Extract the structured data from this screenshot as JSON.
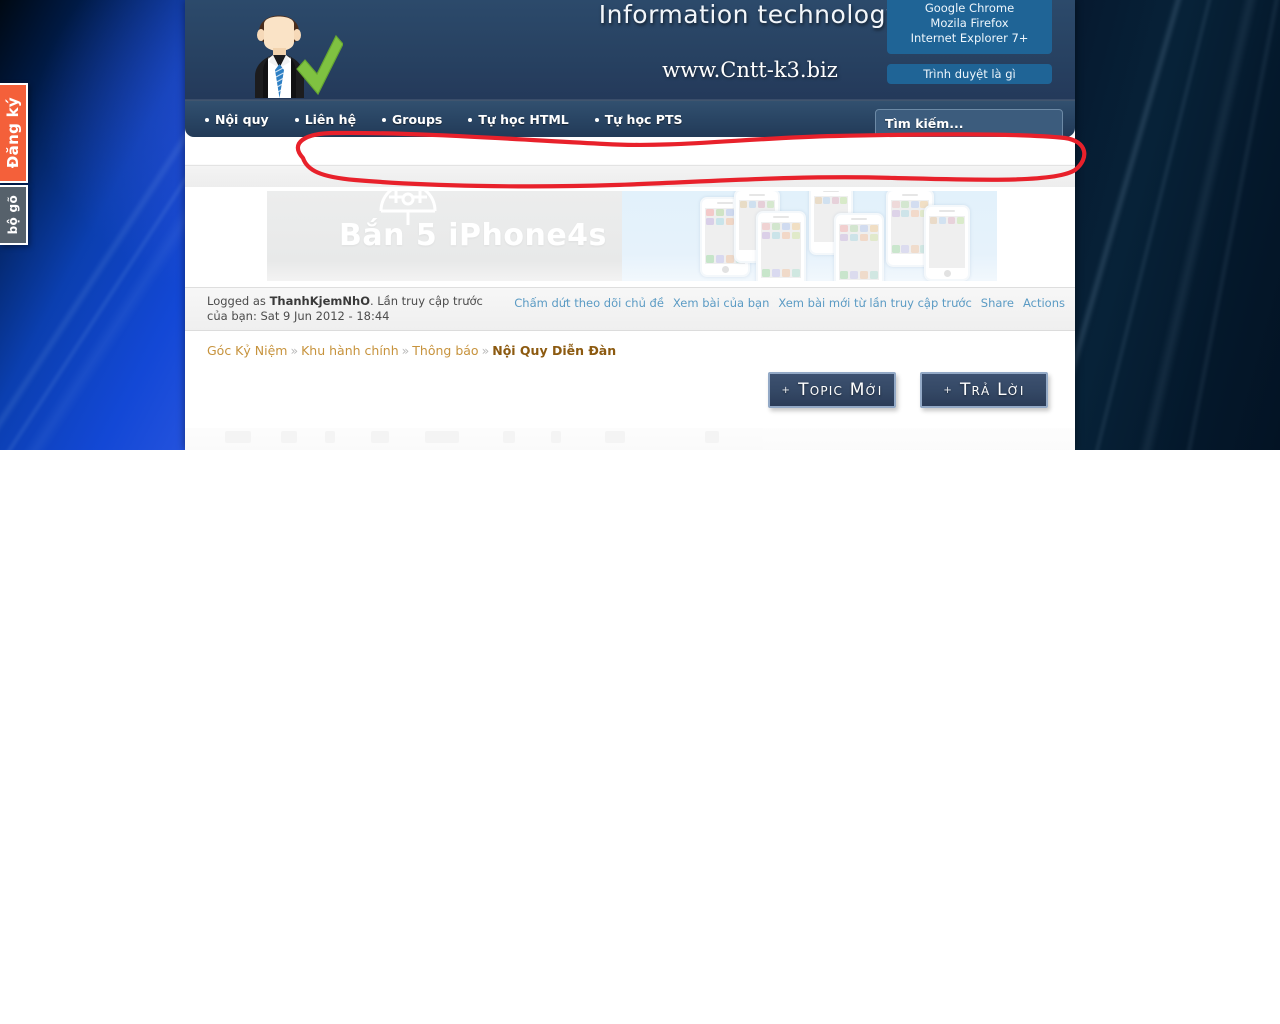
{
  "sidebar_tabs": [
    {
      "name": "register",
      "label": "Đăng ký",
      "color": "#f4603a"
    },
    {
      "name": "input-method",
      "label": "bộ gõ",
      "color": "#56616b"
    }
  ],
  "header": {
    "title": "Information technology",
    "url": "www.Cntt-k3.biz",
    "logo_icon": "businessman-check-icon",
    "browser_box": {
      "lines": [
        "Google Chrome",
        "Mozila Firefox",
        "Internet Explorer 7+"
      ],
      "button_label": "Trình duyệt là gì"
    }
  },
  "nav": {
    "items": [
      {
        "label": "Nội quy"
      },
      {
        "label": "Liên hệ"
      },
      {
        "label": "Groups"
      },
      {
        "label": "Tự học HTML"
      },
      {
        "label": "Tự học PTS"
      }
    ],
    "search_placeholder": "Tìm kiếm..."
  },
  "promo": {
    "headline": "Bắn 5 iPhone4s",
    "icon": "crosshair-target-icon"
  },
  "logged_bar": {
    "prefix": "Logged as ",
    "username": "ThanhKjemNhO",
    "suffix": ". Lần truy cập trước của bạn: Sat 9 Jun 2012 - 18:44",
    "links": [
      "Chấm dứt theo dõi chủ đề",
      "Xem bài của bạn",
      "Xem bài mới từ lần truy cập trước",
      "Share",
      "Actions"
    ]
  },
  "breadcrumb": {
    "items": [
      "Góc Kỷ Niệm",
      "Khu hành chính",
      "Thông báo"
    ],
    "current": "Nội Quy Diễn Đàn",
    "separator": "»"
  },
  "actions": {
    "new_topic_label": "Topic Mới",
    "reply_label": "Trả Lời",
    "plus": "+"
  },
  "annotation": {
    "type": "hand-drawn-red-ellipse",
    "color": "#e8212b"
  },
  "colors": {
    "header_blue": "#274161",
    "nav_blue": "#2a4665",
    "accent_orange": "#f4603a",
    "link_blue": "#5b9bc4",
    "breadcrumb_orange": "#c7933d",
    "annotation_red": "#e8212b"
  }
}
